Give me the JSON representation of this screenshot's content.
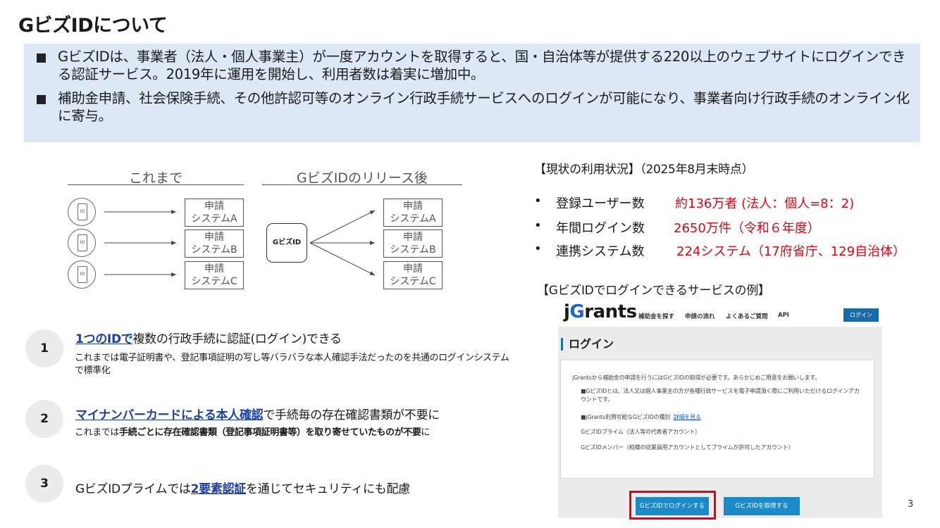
{
  "title": "GビズIDについて",
  "summary": [
    "GビズIDは、事業者（法人・個人事業主）が一度アカウントを取得すると、国・自治体等が提供する220以上のウェブサイトにログインできる認証サービス。2019年に運用を開始し、利用者数は着実に増加中。",
    "補助金申請、社会保険手続、その他許認可等のオンライン行政手続サービスへのログインが可能になり、事業者向け行政手続のオンライン化に寄与。"
  ],
  "diagram": {
    "before_heading": "これまで",
    "after_heading": "GビズIDのリリース後",
    "phone_label": "ID",
    "system_line1": "申請",
    "systems": [
      "システムA",
      "システムB",
      "システムC"
    ],
    "gbiz_label": "GビズID"
  },
  "features": [
    {
      "number": "1",
      "title_em": "1つのIDで",
      "title_rest": "複数の行政手続に認証(ログイン)できる",
      "desc": "これまでは電子証明書や、登記事項証明の写し等バラバラな本人確認手法だったのを共通のログインシステムで標準化"
    },
    {
      "number": "2",
      "title_em": "マイナンバーカードによる本人確認",
      "title_rest": "で手続毎の存在確認書類が不要に",
      "desc_pre": "これまでは",
      "desc_bold": "手続ごとに存在確認書類（登記事項証明書等）を取り寄せていたものが不要",
      "desc_post": "に"
    },
    {
      "number": "3",
      "title_pre": "GビズIDプライムでは",
      "title_em": "2要素認証",
      "title_rest": "を通じてセキュリティにも配慮"
    }
  ],
  "status": {
    "heading": "【現状の利用状況】（2025年8月末時点）",
    "bullet": "•",
    "items": [
      {
        "label": "登録ユーザー数",
        "value": "約136万者 (法人：個人=8：2)"
      },
      {
        "label": "年間ログイン数",
        "value": "2650万件（令和６年度）"
      },
      {
        "label": "連携システム数",
        "value": "224システム（17府省庁、129自治体）"
      }
    ]
  },
  "example_heading": "【GビズIDでログインできるサービスの例】",
  "jgrants": {
    "logo_j": "j",
    "logo_g": "G",
    "logo_rest": "rants",
    "nav": [
      "補助金を探す",
      "申請の流れ",
      "よくあるご質問",
      "API"
    ],
    "login_button": "ログイン",
    "page_title": "ログイン",
    "intro": "jGrantsから補助金の申請を行うにはGビズIDの取得が必要です。あらかじめご用意をお願いします。",
    "note1": "■GビズIDとは、法人又は個人事業主の方が各種行政サービスを電子申請頂く際にご利用いただけるログインアカウントです。",
    "note2": "■jGrants利用可能なGビズIDの種別",
    "note2_link": "詳細を見る",
    "prime": "GビズIDプライム（法人等の代表者アカウント）",
    "member": "GビズIDメンバー（組織の従業員用アカウントとしてプライムが許可したアカウント）",
    "btn_login": "GビズIDでログインする",
    "btn_get": "GビズIDを取得する"
  },
  "page_number": "3",
  "colors": {
    "accent_red": "#e60012",
    "link_blue": "#1b3fa6",
    "summary_bg": "#dde8f7"
  }
}
